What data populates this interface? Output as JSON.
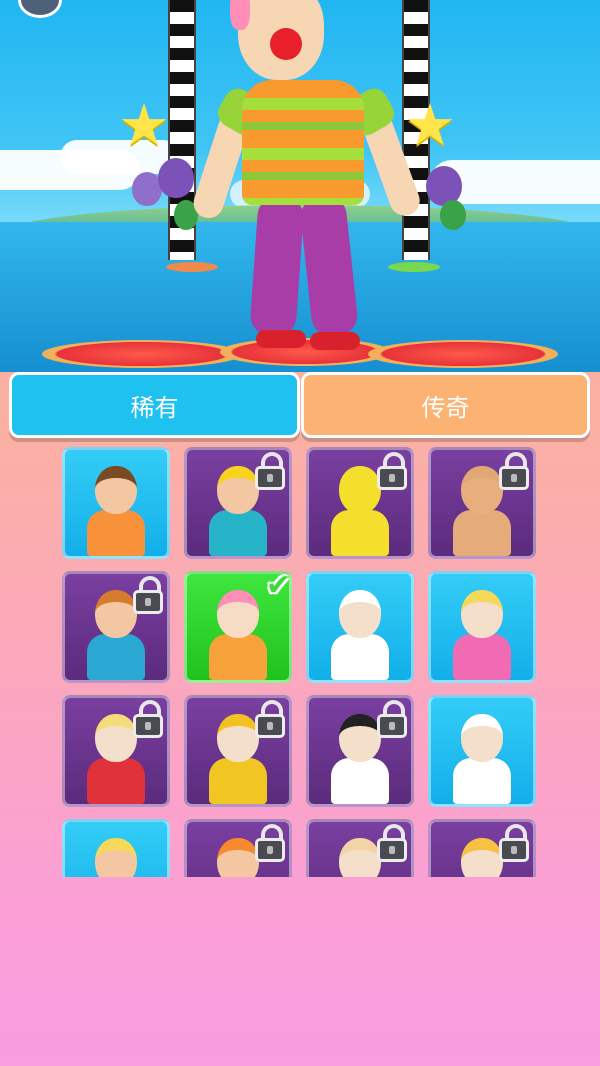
{
  "tabs": {
    "rare_label": "稀有",
    "legend_label": "传奇",
    "active": "rare"
  },
  "colors": {
    "tab_rare": "#1fc1f0",
    "tab_legend": "#fbb272",
    "card_unlocked": "#1fbcef",
    "card_locked": "#6a3590",
    "card_selected": "#2ed22a"
  },
  "skins": [
    {
      "name": "default-orange-shirt",
      "state": "unlocked",
      "hair": "#7a4a23",
      "skin": "#f2c7a1",
      "body": "#f7923a"
    },
    {
      "name": "yellow-hat-teal-shirt",
      "state": "locked",
      "hair": "#f7d21e",
      "skin": "#f2c7a1",
      "body": "#27b4c9"
    },
    {
      "name": "yellow-robot",
      "state": "locked",
      "hair": "#f4e02c",
      "skin": "#f4e02c",
      "body": "#f4e02c"
    },
    {
      "name": "boxer",
      "state": "locked",
      "hair": "#e1a874",
      "skin": "#e8ae7d",
      "body": "#e6ab7a"
    },
    {
      "name": "bearded-blue-suit",
      "state": "locked",
      "hair": "#d67a2b",
      "skin": "#f2c7a1",
      "body": "#2aa8d3"
    },
    {
      "name": "clown",
      "state": "selected",
      "hair": "#ff8fb7",
      "skin": "#f6dcc4",
      "body": "#f7a23b"
    },
    {
      "name": "chef",
      "state": "unlocked",
      "hair": "#ffffff",
      "skin": "#f4dfcb",
      "body": "#ffffff"
    },
    {
      "name": "pink-dress",
      "state": "unlocked",
      "hair": "#f7d95a",
      "skin": "#f4dfcb",
      "body": "#f06bb4"
    },
    {
      "name": "farmer-straw-hat",
      "state": "locked",
      "hair": "#f3dc7a",
      "skin": "#f4dfcb",
      "body": "#e0323a"
    },
    {
      "name": "firefighter",
      "state": "locked",
      "hair": "#f4c122",
      "skin": "#f4dfcb",
      "body": "#f2c622"
    },
    {
      "name": "karate",
      "state": "locked",
      "hair": "#222222",
      "skin": "#f4dfcb",
      "body": "#ffffff"
    },
    {
      "name": "nurse",
      "state": "unlocked",
      "hair": "#ffffff",
      "skin": "#f4dfcb",
      "body": "#ffffff"
    },
    {
      "name": "sunglasses-blonde",
      "state": "unlocked",
      "hair": "#f7d95a",
      "skin": "#f2c7a1",
      "body": "#27b4c9"
    },
    {
      "name": "orange-cap",
      "state": "locked",
      "hair": "#f68a2c",
      "skin": "#f2c7a1",
      "body": "#f68a2c"
    },
    {
      "name": "cyclist-helmet",
      "state": "locked",
      "hair": "#f3d4a6",
      "skin": "#f4dfcb",
      "body": "#e0a36b"
    },
    {
      "name": "skier-goggles",
      "state": "locked",
      "hair": "#f7c241",
      "skin": "#f4dfcb",
      "body": "#3fb7d9"
    }
  ]
}
